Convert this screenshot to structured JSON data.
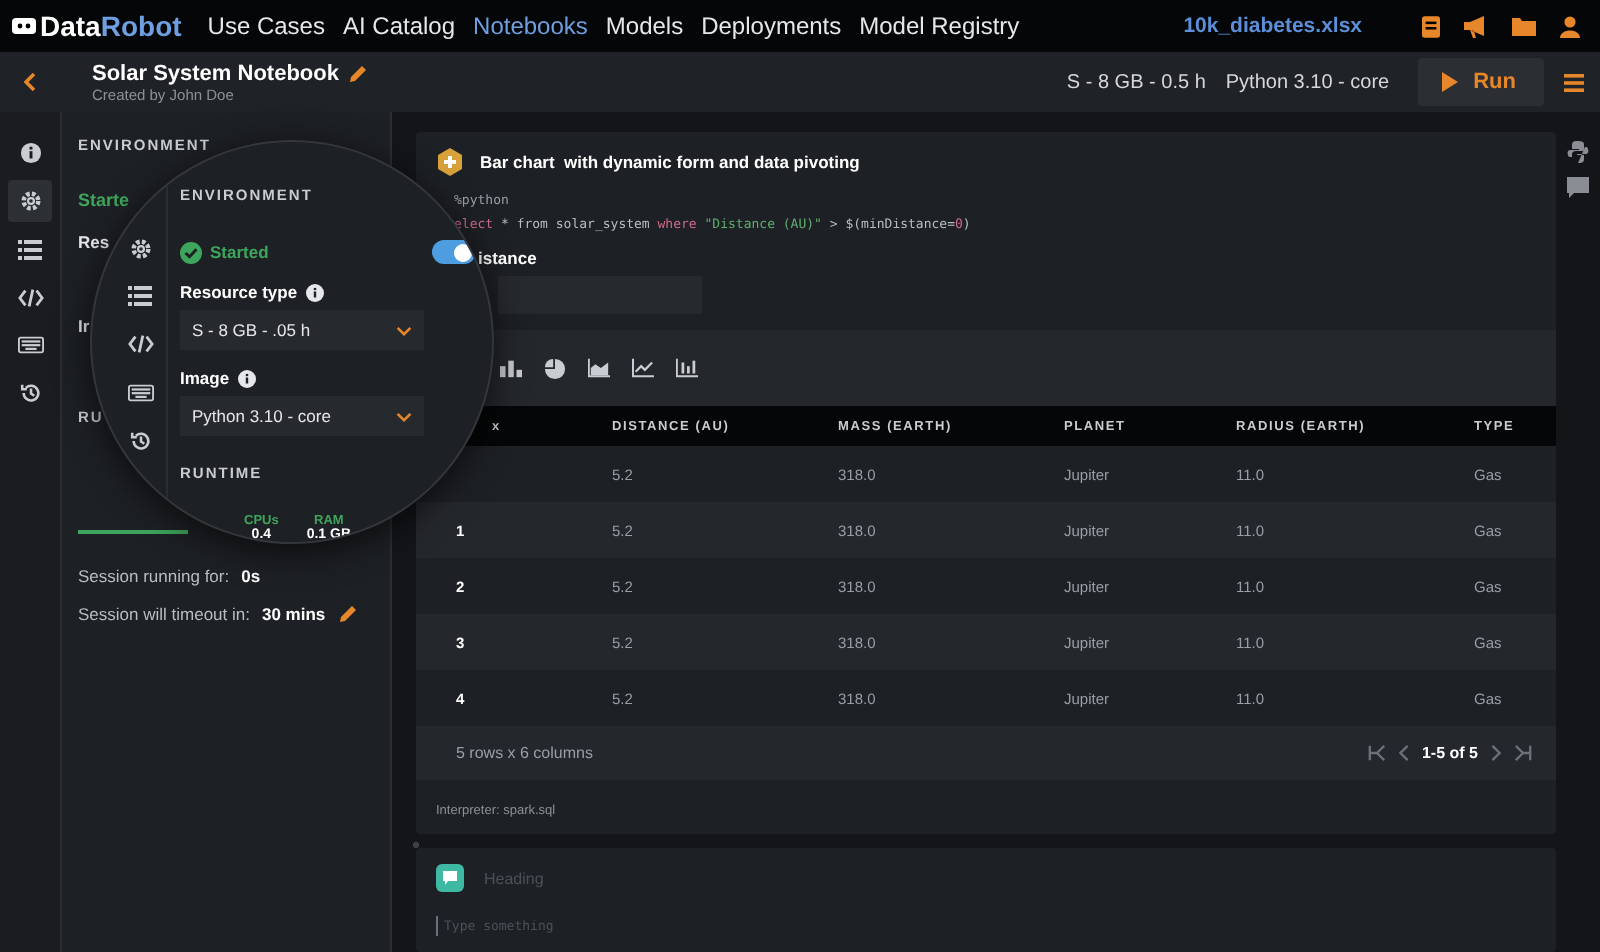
{
  "top_nav": {
    "logo": {
      "first": "Data",
      "second": "Robot"
    },
    "items": [
      {
        "label": "Use Cases",
        "selected": false
      },
      {
        "label": "AI Catalog",
        "selected": false
      },
      {
        "label": "Notebooks",
        "selected": true
      },
      {
        "label": "Models",
        "selected": false
      },
      {
        "label": "Deployments",
        "selected": false
      },
      {
        "label": "Model Registry",
        "selected": false
      }
    ],
    "file_link": "10k_diabetes.xlsx"
  },
  "notebook_header": {
    "title": "Solar System Notebook",
    "author": "Created by John Doe",
    "resource": "S - 8 GB - 0.5 h",
    "image": "Python 3.10 - core",
    "run_button": "Run"
  },
  "side_rail": {
    "items": [
      {
        "kind": "info",
        "selected": false
      },
      {
        "kind": "settings",
        "selected": true
      },
      {
        "kind": "list",
        "selected": false
      },
      {
        "kind": "code",
        "selected": false
      },
      {
        "kind": "keyboard",
        "selected": false
      },
      {
        "kind": "history",
        "selected": false
      }
    ]
  },
  "environment_panel": {
    "heading": "ENVIRONMENT",
    "status": "Starte",
    "resource_label": "Res",
    "image_label": "Ir",
    "runtime_heading": "RU",
    "session_running_label": "Session running for:",
    "session_running_value": "0s",
    "timeout_label": "Session will timeout in:",
    "timeout_value": "30 mins"
  },
  "magnifier": {
    "rail_items": [
      {
        "kind": "settings"
      },
      {
        "kind": "list"
      },
      {
        "kind": "code"
      },
      {
        "kind": "keyboard"
      },
      {
        "kind": "history"
      }
    ],
    "heading": "ENVIRONMENT",
    "status": "Started",
    "started": true,
    "resource_label": "Resource type",
    "resource_value": "S - 8 GB - .05 h",
    "image_label": "Image",
    "image_value": "Python 3.10 - core",
    "runtime_heading": "RUNTIME",
    "stats": [
      {
        "label": "CPUs",
        "value": "0.4"
      },
      {
        "label": "RAM",
        "value": "0.1 GB"
      }
    ]
  },
  "cell": {
    "title": "Bar chart  with dynamic form and data pivoting",
    "magic": "%python",
    "code": [
      {
        "text": "elect",
        "kind": "keyword"
      },
      {
        "text": " * from solar_system ",
        "kind": "plain"
      },
      {
        "text": "where",
        "kind": "keyword"
      },
      {
        "text": " \"Distance (AU)\"",
        "kind": "string"
      },
      {
        "text": " > $(minDistance=",
        "kind": "plain"
      },
      {
        "text": "0",
        "kind": "keyword"
      },
      {
        "text": ")",
        "kind": "plain"
      }
    ],
    "form_label": "istance",
    "chart_types": [
      {
        "kind": "bar"
      },
      {
        "kind": "pie"
      },
      {
        "kind": "area"
      },
      {
        "kind": "line"
      },
      {
        "kind": "scatter"
      }
    ],
    "table": {
      "columns": [
        "x",
        "DISTANCE (AU)",
        "MASS (EARTH)",
        "PLANET",
        "RADIUS (EARTH)",
        "TYPE"
      ],
      "rows": [
        [
          "",
          "5.2",
          "318.0",
          "Jupiter",
          "11.0",
          "Gas"
        ],
        [
          "1",
          "5.2",
          "318.0",
          "Jupiter",
          "11.0",
          "Gas"
        ],
        [
          "2",
          "5.2",
          "318.0",
          "Jupiter",
          "11.0",
          "Gas"
        ],
        [
          "3",
          "5.2",
          "318.0",
          "Jupiter",
          "11.0",
          "Gas"
        ],
        [
          "4",
          "5.2",
          "318.0",
          "Jupiter",
          "11.0",
          "Gas"
        ]
      ],
      "summary": "5 rows x 6 columns",
      "pagination": "1-5 of 5"
    },
    "interpreter": "Interpreter: spark.sql"
  },
  "text_cell": {
    "heading_placeholder": "Heading",
    "body_placeholder": "Type something"
  }
}
